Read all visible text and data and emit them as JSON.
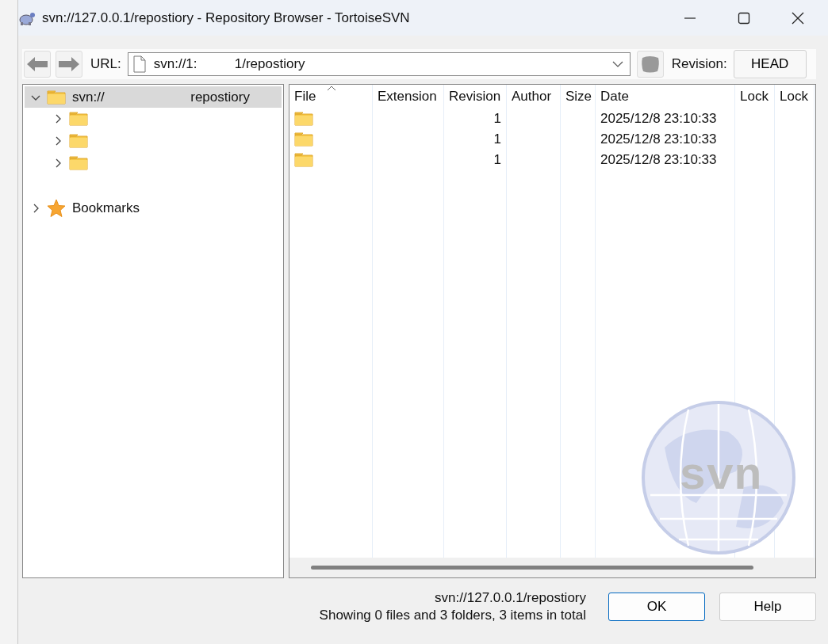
{
  "window": {
    "title": "svn://127.0.0.1/repostiory - Repository Browser - TortoiseSVN"
  },
  "toolbar": {
    "url_label": "URL:",
    "url": "svn://1:          1/repostiory",
    "revision_label": "Revision:",
    "revision_button": "HEAD"
  },
  "tree": [
    {
      "label": "svn://                       repostiory",
      "kind": "folder",
      "expanded": true,
      "selected": true,
      "children": [
        {
          "kind": "folder",
          "expanded": false,
          "selected": false
        },
        {
          "kind": "folder",
          "expanded": false,
          "selected": false
        },
        {
          "kind": "folder",
          "expanded": false,
          "selected": false
        }
      ]
    },
    {
      "label": "Bookmarks",
      "kind": "bookmarks",
      "expanded": false,
      "selected": false
    }
  ],
  "table": {
    "columns": [
      {
        "label": "File",
        "sorted": true
      },
      {
        "label": "Extension",
        "sorted": false
      },
      {
        "label": "Revision",
        "sorted": false
      },
      {
        "label": "Author",
        "sorted": false
      },
      {
        "label": "Size",
        "sorted": false
      },
      {
        "label": "Date",
        "sorted": false
      },
      {
        "label": "Lock",
        "sorted": false
      },
      {
        "label": "Lock",
        "sorted": false
      }
    ],
    "rows": [
      {
        "kind": "folder",
        "cells": [
          "",
          "",
          "1",
          "",
          "",
          "2025/12/8 23:10:33",
          "",
          ""
        ]
      },
      {
        "kind": "folder",
        "cells": [
          "",
          "",
          "1",
          "",
          "",
          "2025/12/8 23:10:33",
          "",
          ""
        ]
      },
      {
        "kind": "folder",
        "cells": [
          "",
          "",
          "1",
          "",
          "",
          "2025/12/8 23:10:33",
          "",
          ""
        ]
      }
    ],
    "logo_text": "svn"
  },
  "status": {
    "url": "svn://127.0.0.1/repostiory",
    "summary": "Showing 0 files and 3 folders, 3 items in total"
  },
  "buttons": [
    {
      "label": "OK",
      "default": true
    },
    {
      "label": "Help",
      "default": false
    }
  ]
}
